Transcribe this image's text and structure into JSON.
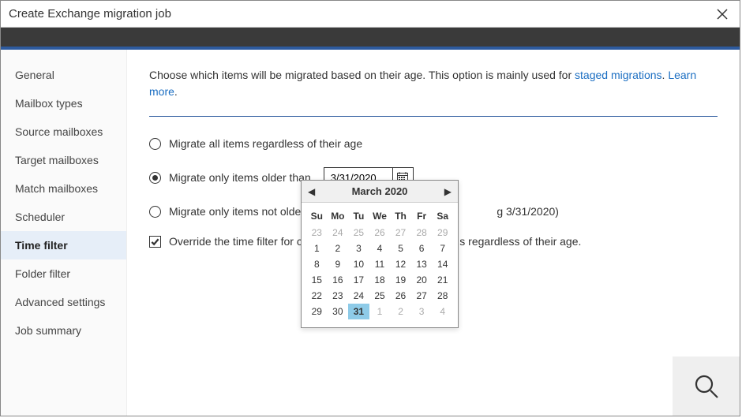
{
  "title": "Create Exchange migration job",
  "sidebar": {
    "items": [
      {
        "label": "General"
      },
      {
        "label": "Mailbox types"
      },
      {
        "label": "Source mailboxes"
      },
      {
        "label": "Target mailboxes"
      },
      {
        "label": "Match mailboxes"
      },
      {
        "label": "Scheduler"
      },
      {
        "label": "Time filter"
      },
      {
        "label": "Folder filter"
      },
      {
        "label": "Advanced settings"
      },
      {
        "label": "Job summary"
      }
    ],
    "selectedIndex": 6
  },
  "intro": {
    "text": "Choose which items will be migrated based on their age. This option is mainly used for ",
    "link1": "staged migrations",
    "sep": ". ",
    "link2": "Learn more",
    "end": "."
  },
  "options": {
    "opt1": "Migrate all items regardless of their age",
    "opt2": "Migrate only items older than",
    "opt3_pre": "Migrate only items not older tha",
    "opt3_post": "g 3/31/2020)",
    "opt4_pre": "Override the time filter for cont",
    "opt4_post": "s regardless of their age.",
    "dateValue": "3/31/2020"
  },
  "calendar": {
    "title": "March 2020",
    "dow": [
      "Su",
      "Mo",
      "Tu",
      "We",
      "Th",
      "Fr",
      "Sa"
    ],
    "days": [
      {
        "n": "23",
        "o": true
      },
      {
        "n": "24",
        "o": true
      },
      {
        "n": "25",
        "o": true
      },
      {
        "n": "26",
        "o": true
      },
      {
        "n": "27",
        "o": true
      },
      {
        "n": "28",
        "o": true
      },
      {
        "n": "29",
        "o": true
      },
      {
        "n": "1"
      },
      {
        "n": "2"
      },
      {
        "n": "3"
      },
      {
        "n": "4"
      },
      {
        "n": "5"
      },
      {
        "n": "6"
      },
      {
        "n": "7"
      },
      {
        "n": "8"
      },
      {
        "n": "9"
      },
      {
        "n": "10"
      },
      {
        "n": "11"
      },
      {
        "n": "12"
      },
      {
        "n": "13"
      },
      {
        "n": "14"
      },
      {
        "n": "15"
      },
      {
        "n": "16"
      },
      {
        "n": "17"
      },
      {
        "n": "18"
      },
      {
        "n": "19"
      },
      {
        "n": "20"
      },
      {
        "n": "21"
      },
      {
        "n": "22"
      },
      {
        "n": "23"
      },
      {
        "n": "24"
      },
      {
        "n": "25"
      },
      {
        "n": "26"
      },
      {
        "n": "27"
      },
      {
        "n": "28"
      },
      {
        "n": "29"
      },
      {
        "n": "30"
      },
      {
        "n": "31",
        "sel": true
      },
      {
        "n": "1",
        "o": true
      },
      {
        "n": "2",
        "o": true
      },
      {
        "n": "3",
        "o": true
      },
      {
        "n": "4",
        "o": true
      }
    ]
  }
}
